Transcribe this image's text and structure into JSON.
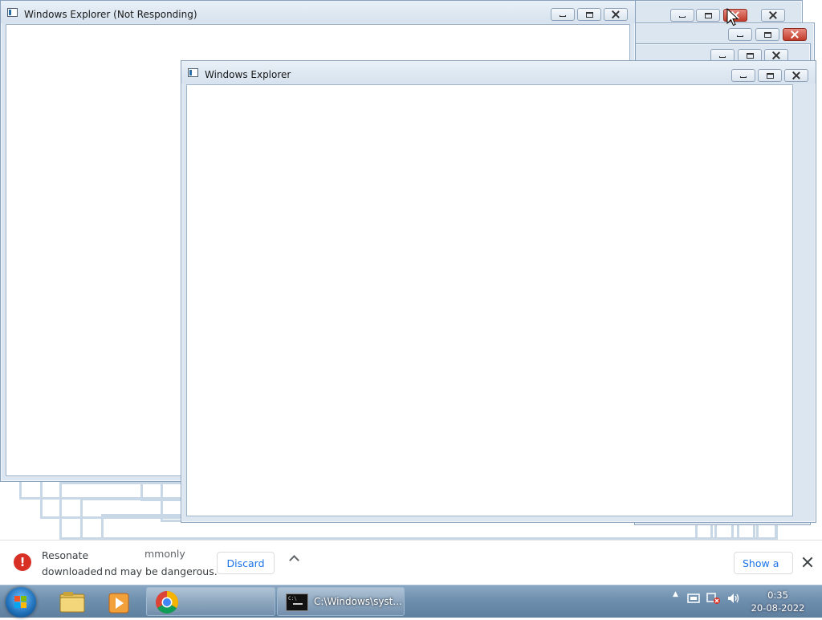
{
  "windows": {
    "front": {
      "title": "Windows Explorer"
    },
    "back": {
      "title": "Windows Explorer (Not Responding)"
    }
  },
  "download_bar": {
    "line1": "Resonate",
    "line1_tail": "mmonly",
    "line2a": "downloaded",
    "line2b": "nd may be dangerous.",
    "discard": "Discard",
    "show_all": "Show a"
  },
  "taskbar": {
    "cmd_label": "C:\\Windows\\syst...",
    "clock_time": "0:35",
    "clock_date": "20-08-2022"
  },
  "colors": {
    "close_hover": "#c23b2a",
    "taskbar": "#6f8fae",
    "warning": "#d93025",
    "link": "#1a73e8"
  }
}
